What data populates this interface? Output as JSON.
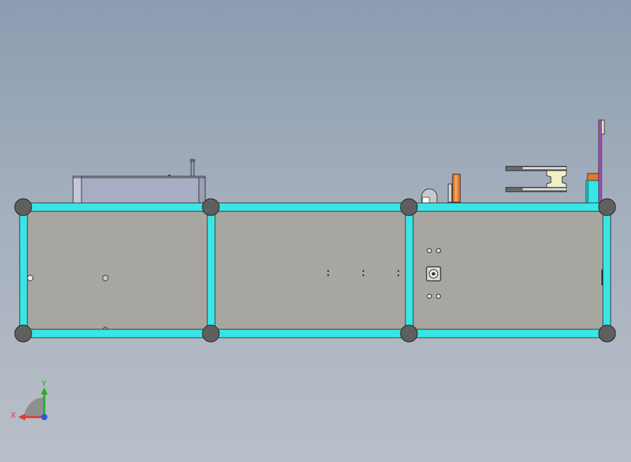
{
  "view": {
    "title": "",
    "background_colors": [
      "#8c9cb0",
      "#b9bfc8"
    ]
  },
  "model": {
    "frame_color": "#39e6e6",
    "panel_color": "#a8a6a0",
    "node_color": "#5f5f5f",
    "accent_colors": {
      "orange": "#e07a2a",
      "magenta": "#b24fc8",
      "cream": "#f1efc7",
      "blue_grey": "#a9adc4"
    }
  },
  "triad": {
    "x_label": "X",
    "y_label": "Y",
    "x_color": "#e03a3a",
    "y_color": "#22b022",
    "z_color": "#2a5bd8"
  }
}
